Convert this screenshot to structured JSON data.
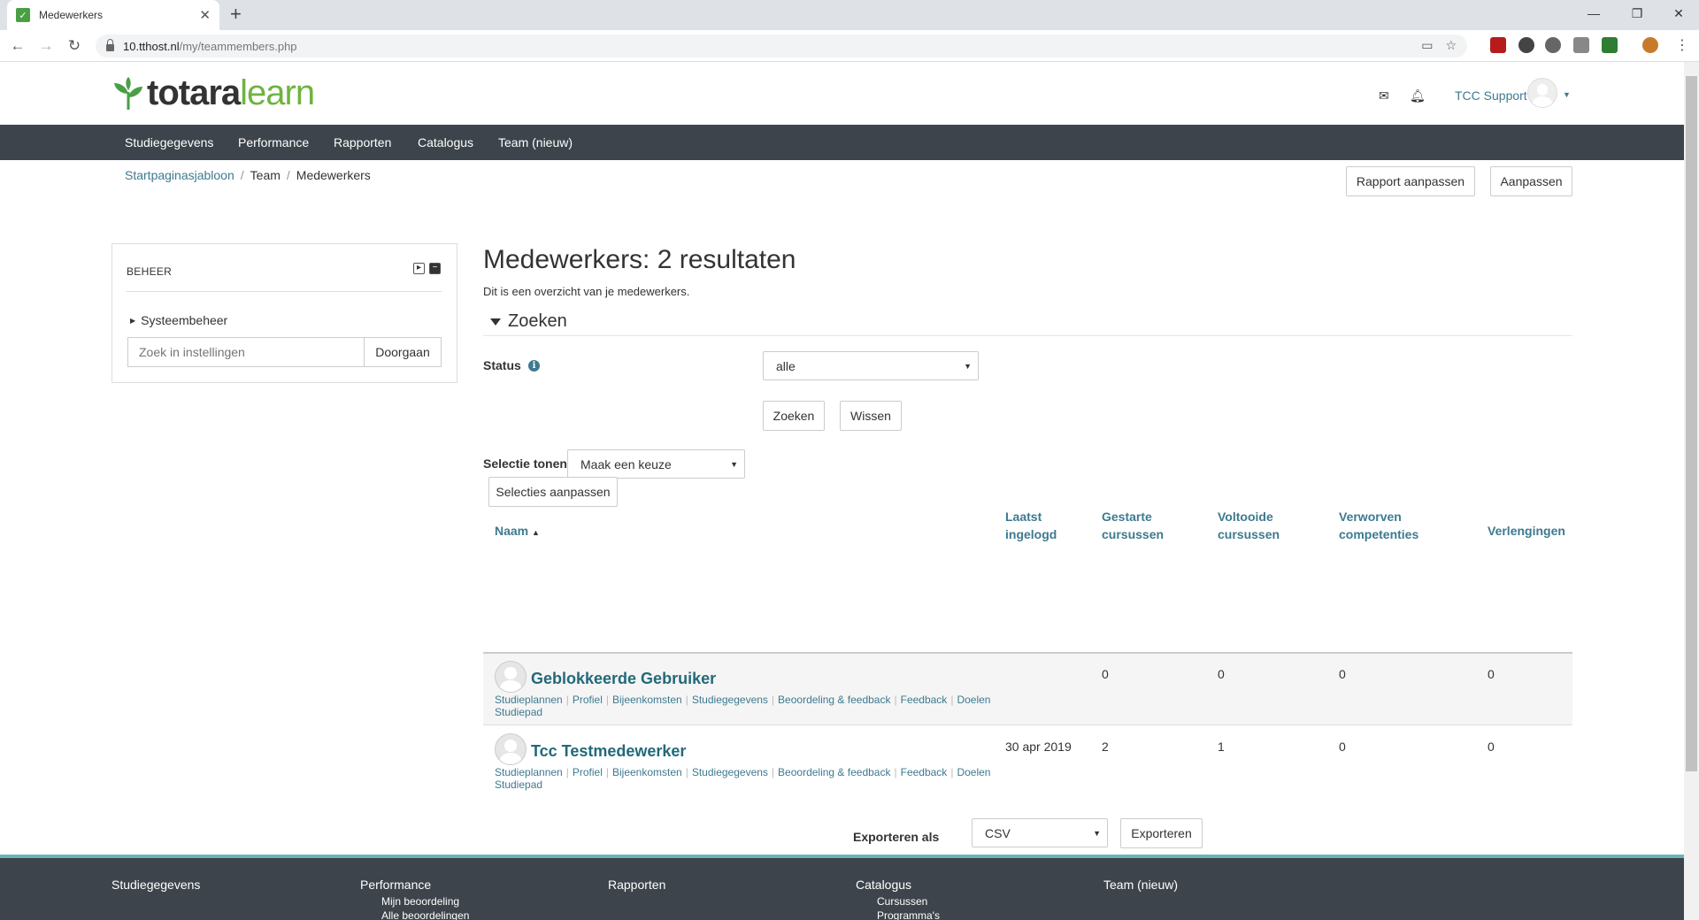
{
  "browser": {
    "tab_title": "Medewerkers",
    "url_host": "10.tthost.nl",
    "url_path": "/my/teammembers.php"
  },
  "header": {
    "logo_main": "totara",
    "logo_accent": "learn",
    "user_name": "TCC Support"
  },
  "nav": {
    "items": [
      "Studiegegevens",
      "Performance",
      "Rapporten",
      "Catalogus",
      "Team (nieuw)"
    ]
  },
  "breadcrumb": {
    "items": [
      "Startpaginasjabloon",
      "Team",
      "Medewerkers"
    ]
  },
  "page_actions": {
    "report_customize": "Rapport aanpassen",
    "customize": "Aanpassen"
  },
  "admin_block": {
    "title": "BEHEER",
    "tree_item": "Systeembeheer",
    "search_placeholder": "Zoek in instellingen",
    "search_button": "Doorgaan"
  },
  "main": {
    "title": "Medewerkers: 2 resultaten",
    "description": "Dit is een overzicht van je medewerkers.",
    "search_legend": "Zoeken",
    "status_label": "Status",
    "status_value": "alle",
    "search_button": "Zoeken",
    "clear_button": "Wissen",
    "show_selection_label": "Selectie tonen",
    "show_selection_value": "Maak een keuze",
    "edit_selections_button": "Selecties aanpassen"
  },
  "table": {
    "headers": {
      "name": "Naam",
      "last_login_1": "Laatst",
      "last_login_2": "ingelogd",
      "started_1": "Gestarte",
      "started_2": "cursussen",
      "completed_1": "Voltooide",
      "completed_2": "cursussen",
      "earned_1": "Verworven",
      "earned_2": "competenties",
      "extensions": "Verlengingen"
    },
    "link_labels": [
      "Studieplannen",
      "Profiel",
      "Bijeenkomsten",
      "Studiegegevens",
      "Beoordeling & feedback",
      "Feedback",
      "Doelen",
      "Studiepad"
    ],
    "rows": [
      {
        "name": "Geblokkeerde Gebruiker",
        "last_login": "",
        "started": "0",
        "completed": "0",
        "earned": "0",
        "extensions": "0"
      },
      {
        "name": "Tcc Testmedewerker",
        "last_login": "30 apr 2019",
        "started": "2",
        "completed": "1",
        "earned": "0",
        "extensions": "0"
      }
    ]
  },
  "export": {
    "label": "Exporteren als",
    "format": "CSV",
    "button": "Exporteren"
  },
  "footer": {
    "columns": [
      {
        "title": "Studiegegevens",
        "items": []
      },
      {
        "title": "Performance",
        "items": [
          "Mijn beoordeling",
          "Alle beoordelingen"
        ]
      },
      {
        "title": "Rapporten",
        "items": []
      },
      {
        "title": "Catalogus",
        "items": [
          "Cursussen",
          "Programma's"
        ]
      },
      {
        "title": "Team (nieuw)",
        "items": []
      }
    ]
  },
  "colors": {
    "nav_bg": "#3d444b",
    "link": "#3d7a8f",
    "brand_green": "#6fb33f",
    "footer_accent": "#69b6b8"
  }
}
